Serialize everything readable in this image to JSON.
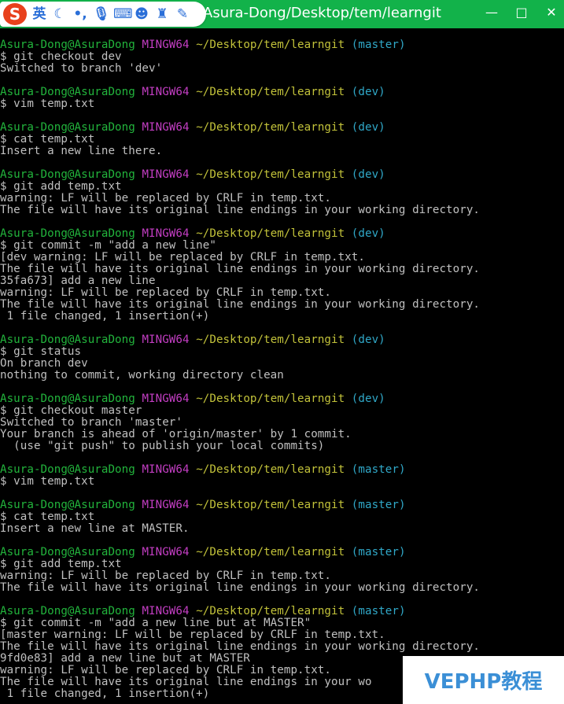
{
  "titlebar": {
    "title": "Asura-Dong/Desktop/tem/learngit",
    "ime_logo": "S",
    "ime_lang": "英",
    "ime_icons": [
      "moon-icon",
      "punctuation-icon",
      "microphone-icon",
      "keyboard-icon",
      "user-icon",
      "shirt-icon",
      "wrench-icon"
    ],
    "controls": {
      "minimize": "—",
      "maximize": "□",
      "close": "✕"
    }
  },
  "colors": {
    "user": "#22b43c",
    "system": "#c33ec3",
    "path": "#c2c23a",
    "branch": "#30a8c8",
    "output": "#c0c0c0",
    "titlebar": "#12b24a"
  },
  "prompt": {
    "user": "Asura-Dong@AsuraDong",
    "system": "MINGW64",
    "path": "~/Desktop/tem/learngit"
  },
  "lines": [
    {
      "t": "prompt",
      "branch": "(master)"
    },
    {
      "t": "text",
      "text": "$ git checkout dev"
    },
    {
      "t": "text",
      "text": "Switched to branch 'dev'"
    },
    {
      "t": "blank"
    },
    {
      "t": "prompt",
      "branch": "(dev)"
    },
    {
      "t": "text",
      "text": "$ vim temp.txt"
    },
    {
      "t": "blank"
    },
    {
      "t": "prompt",
      "branch": "(dev)"
    },
    {
      "t": "text",
      "text": "$ cat temp.txt"
    },
    {
      "t": "text",
      "text": "Insert a new line there."
    },
    {
      "t": "blank"
    },
    {
      "t": "prompt",
      "branch": "(dev)"
    },
    {
      "t": "text",
      "text": "$ git add temp.txt"
    },
    {
      "t": "text",
      "text": "warning: LF will be replaced by CRLF in temp.txt."
    },
    {
      "t": "text",
      "text": "The file will have its original line endings in your working directory."
    },
    {
      "t": "blank"
    },
    {
      "t": "prompt",
      "branch": "(dev)"
    },
    {
      "t": "text",
      "text": "$ git commit -m \"add a new line\""
    },
    {
      "t": "text",
      "text": "[dev warning: LF will be replaced by CRLF in temp.txt."
    },
    {
      "t": "text",
      "text": "The file will have its original line endings in your working directory."
    },
    {
      "t": "text",
      "text": "35fa673] add a new line"
    },
    {
      "t": "text",
      "text": "warning: LF will be replaced by CRLF in temp.txt."
    },
    {
      "t": "text",
      "text": "The file will have its original line endings in your working directory."
    },
    {
      "t": "text",
      "text": " 1 file changed, 1 insertion(+)"
    },
    {
      "t": "blank"
    },
    {
      "t": "prompt",
      "branch": "(dev)"
    },
    {
      "t": "text",
      "text": "$ git status"
    },
    {
      "t": "text",
      "text": "On branch dev"
    },
    {
      "t": "text",
      "text": "nothing to commit, working directory clean"
    },
    {
      "t": "blank"
    },
    {
      "t": "prompt",
      "branch": "(dev)"
    },
    {
      "t": "text",
      "text": "$ git checkout master"
    },
    {
      "t": "text",
      "text": "Switched to branch 'master'"
    },
    {
      "t": "text",
      "text": "Your branch is ahead of 'origin/master' by 1 commit."
    },
    {
      "t": "text",
      "text": "  (use \"git push\" to publish your local commits)"
    },
    {
      "t": "blank"
    },
    {
      "t": "prompt",
      "branch": "(master)"
    },
    {
      "t": "text",
      "text": "$ vim temp.txt"
    },
    {
      "t": "blank"
    },
    {
      "t": "prompt",
      "branch": "(master)"
    },
    {
      "t": "text",
      "text": "$ cat temp.txt"
    },
    {
      "t": "text",
      "text": "Insert a new line at MASTER."
    },
    {
      "t": "blank"
    },
    {
      "t": "prompt",
      "branch": "(master)"
    },
    {
      "t": "text",
      "text": "$ git add temp.txt"
    },
    {
      "t": "text",
      "text": "warning: LF will be replaced by CRLF in temp.txt."
    },
    {
      "t": "text",
      "text": "The file will have its original line endings in your working directory."
    },
    {
      "t": "blank"
    },
    {
      "t": "prompt",
      "branch": "(master)"
    },
    {
      "t": "text",
      "text": "$ git commit -m \"add a new line but at MASTER\""
    },
    {
      "t": "text",
      "text": "[master warning: LF will be replaced by CRLF in temp.txt."
    },
    {
      "t": "text",
      "text": "The file will have its original line endings in your working directory."
    },
    {
      "t": "text",
      "text": "9fd0e83] add a new line but at MASTER"
    },
    {
      "t": "text",
      "text": "warning: LF will be replaced by CRLF in temp.txt."
    },
    {
      "t": "text",
      "text": "The file will have its original line endings in your wo"
    },
    {
      "t": "text",
      "text": " 1 file changed, 1 insertion(+)"
    }
  ],
  "watermark": "VEPHP教程"
}
